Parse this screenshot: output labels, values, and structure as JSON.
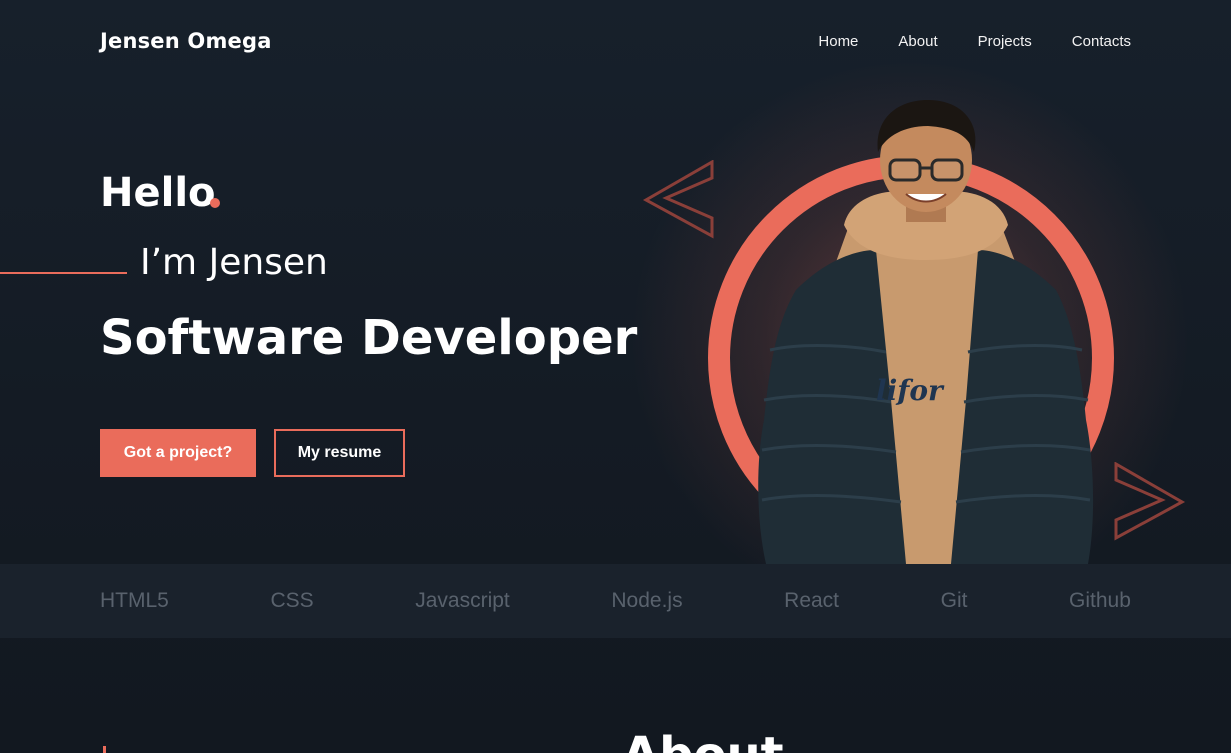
{
  "header": {
    "brand": "Jensen Omega",
    "nav": [
      "Home",
      "About",
      "Projects",
      "Contacts"
    ]
  },
  "hero": {
    "greeting": "Hello",
    "intro": "I’m Jensen",
    "role": "Software Developer",
    "primary_button": "Got a project?",
    "secondary_button": "My resume"
  },
  "skills": [
    "HTML5",
    "CSS",
    "Javascript",
    "Node.js",
    "React",
    "Git",
    "Github"
  ],
  "about": {
    "title": "About"
  },
  "icons": {
    "left_chevron": "chevron-left-icon",
    "right_chevron": "chevron-right-icon"
  },
  "colors": {
    "accent": "#ea6c5b",
    "background": "#141b24",
    "skills_bar": "#1a222c",
    "muted_text": "#59626d"
  }
}
